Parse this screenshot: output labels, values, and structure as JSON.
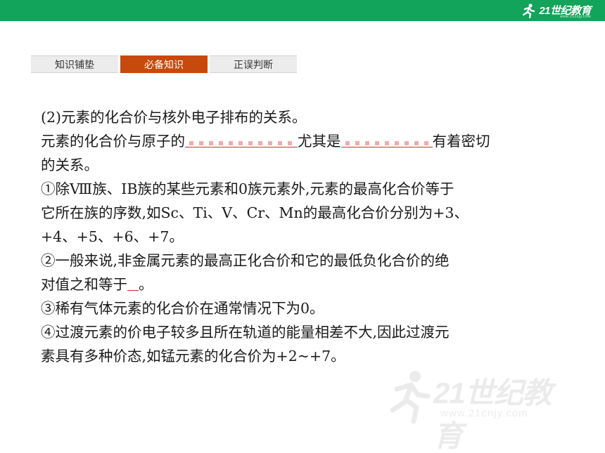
{
  "header": {
    "logo_text": "21世纪教育",
    "logo_sub": "www.21cnjy.com"
  },
  "tabs": [
    {
      "label": "知识铺垫",
      "active": false
    },
    {
      "label": "必备知识",
      "active": true
    },
    {
      "label": "正误判断",
      "active": false
    }
  ],
  "content": {
    "line1": "(2)元素的化合价与核外电子排布的关系。",
    "line2_a": "元素的化合价与原子的",
    "line2_b": "尤其是",
    "line2_c": "有着密切",
    "line3": "的关系。",
    "line4": "①除Ⅷ族、ⅠB族的某些元素和0族元素外,元素的最高化合价等于",
    "line5": "它所在族的序数,如Sc、Ti、V、Cr、Mn的最高化合价分别为+3、",
    "line6": "+4、+5、+6、+7。",
    "line7": "②一般来说,非金属元素的最高正化合价和它的最低负化合价的绝",
    "line8_a": "对值之和等于",
    "line8_b": "。",
    "line9": "③稀有气体元素的化合价在通常情况下为0。",
    "line10": "④过渡元素的价电子较多且所在轨道的能量相差不大,因此过渡元",
    "line11": "素具有多种价态,如锰元素的化合价为+2~+7。"
  },
  "watermark": {
    "text": "21世纪教育",
    "sub": "www.21cnjy.com"
  },
  "colors": {
    "header_green": "#12a45a",
    "active_tab": "#c7490c",
    "blank_underline": "#d12b2b"
  }
}
